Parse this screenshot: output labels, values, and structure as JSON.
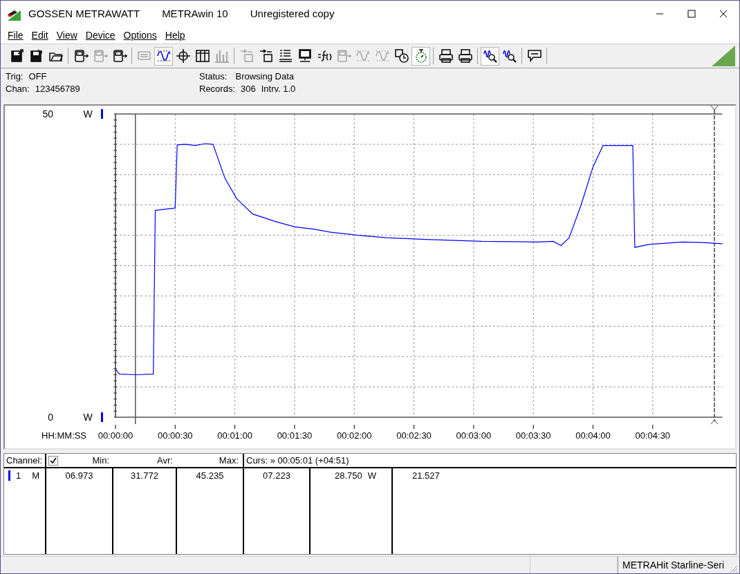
{
  "window": {
    "title_parts": [
      "GOSSEN METRAWATT",
      "METRAwin 10",
      "Unregistered copy"
    ]
  },
  "menu": [
    {
      "label": "File"
    },
    {
      "label": "Edit"
    },
    {
      "label": "View"
    },
    {
      "label": "Device"
    },
    {
      "label": "Options"
    },
    {
      "label": "Help"
    }
  ],
  "toolbar": [
    {
      "buttons": [
        {
          "kind": "disk-out",
          "disabled": false,
          "pressed": false
        },
        {
          "kind": "disk-in",
          "disabled": false,
          "pressed": false
        },
        {
          "kind": "open",
          "disabled": false,
          "pressed": false
        }
      ]
    },
    {
      "buttons": [
        {
          "kind": "meter",
          "disabled": false,
          "pressed": false
        },
        {
          "kind": "meter",
          "disabled": true,
          "pressed": false
        },
        {
          "kind": "meter",
          "disabled": false,
          "pressed": false
        }
      ]
    },
    {
      "buttons": [
        {
          "kind": "display",
          "disabled": true,
          "pressed": false
        },
        {
          "kind": "wave",
          "disabled": false,
          "pressed": true
        },
        {
          "kind": "crosshair",
          "disabled": false,
          "pressed": false
        },
        {
          "kind": "table",
          "disabled": false,
          "pressed": false
        },
        {
          "kind": "bars",
          "disabled": true,
          "pressed": false
        }
      ]
    },
    {
      "buttons": [
        {
          "kind": "transfer",
          "disabled": true,
          "pressed": false
        },
        {
          "kind": "transfer",
          "disabled": false,
          "pressed": false
        },
        {
          "kind": "list",
          "disabled": false,
          "pressed": false
        },
        {
          "kind": "monitor",
          "disabled": false,
          "pressed": false
        },
        {
          "kind": "function",
          "disabled": false,
          "pressed": false
        },
        {
          "kind": "meter",
          "disabled": true,
          "pressed": false
        },
        {
          "kind": "wave",
          "disabled": true,
          "pressed": false
        },
        {
          "kind": "wave",
          "disabled": true,
          "pressed": false
        },
        {
          "kind": "clock",
          "disabled": false,
          "pressed": false
        },
        {
          "kind": "stopwatch",
          "disabled": false,
          "pressed": true
        }
      ]
    },
    {
      "buttons": [
        {
          "kind": "printer",
          "disabled": false,
          "pressed": false
        },
        {
          "kind": "printer",
          "disabled": false,
          "pressed": false
        }
      ]
    },
    {
      "buttons": [
        {
          "kind": "zoom",
          "disabled": false,
          "pressed": true
        },
        {
          "kind": "zoom",
          "disabled": false,
          "pressed": false
        }
      ]
    },
    {
      "buttons": [
        {
          "kind": "comment",
          "disabled": false,
          "pressed": false
        }
      ]
    }
  ],
  "info": {
    "left": [
      {
        "label": "Trig:",
        "value": "OFF"
      },
      {
        "label": "Chan:",
        "value": "123456789"
      }
    ],
    "status": {
      "label": "Status:",
      "value": "Browsing Data"
    },
    "records": {
      "label": "Records:",
      "value": "306",
      "interval": "Intrv. 1.0"
    }
  },
  "chart": {
    "y_units": [
      "W",
      "W"
    ],
    "chart_data": {
      "type": "line",
      "xlabel": "HH:MM:SS",
      "xlim": [
        0,
        305
      ],
      "ylim": [
        0,
        50
      ],
      "yticks": [
        {
          "value": 50,
          "label": "50"
        },
        {
          "value": 0,
          "label": "0"
        }
      ],
      "xticks": [
        {
          "value": 0,
          "label": "00:00:00"
        },
        {
          "value": 30,
          "label": "00:00:30"
        },
        {
          "value": 60,
          "label": "00:01:00"
        },
        {
          "value": 90,
          "label": "00:01:30"
        },
        {
          "value": 120,
          "label": "00:02:00"
        },
        {
          "value": 150,
          "label": "00:02:30"
        },
        {
          "value": 180,
          "label": "00:03:00"
        },
        {
          "value": 210,
          "label": "00:03:30"
        },
        {
          "value": 240,
          "label": "00:04:00"
        },
        {
          "value": 270,
          "label": "00:04:30"
        }
      ],
      "x": [
        0,
        2,
        10,
        19,
        20,
        25,
        30,
        31,
        35,
        40,
        45,
        49,
        55,
        61,
        69,
        80,
        90,
        100,
        108,
        122,
        136,
        156,
        184,
        212,
        220,
        224,
        228,
        234,
        240,
        245,
        260,
        261,
        268,
        285,
        295,
        305
      ],
      "series": [
        {
          "color": "#0000ff",
          "values": [
            7.9,
            7.1,
            7.0,
            7.1,
            34.1,
            34.3,
            34.5,
            44.9,
            45.0,
            44.8,
            45.1,
            45.0,
            39.4,
            36.0,
            33.5,
            32.3,
            31.4,
            31.0,
            30.5,
            30.0,
            29.6,
            29.3,
            29.0,
            28.9,
            29.0,
            28.3,
            29.6,
            35.0,
            41.3,
            44.8,
            44.8,
            28.0,
            28.5,
            28.9,
            28.8,
            28.6
          ]
        }
      ],
      "grid": true,
      "ref_lines": [
        {
          "axis": "x",
          "value": 10
        },
        {
          "axis": "x",
          "value": 301
        }
      ]
    }
  },
  "table": {
    "header": {
      "channel": "Channel:",
      "checked": true,
      "min": "Min:",
      "avr": "Avr:",
      "max": "Max:",
      "cursor": "Curs: » 00:05:01 (+04:51)"
    },
    "rows": [
      {
        "color": "#0000ff",
        "number": "1",
        "mode": "M",
        "min": "06.973",
        "avr": "31.772",
        "max": "45.235",
        "cursor_1": "07.223",
        "cursor_2": "28.750",
        "unit": "W",
        "delta": "21.527"
      }
    ]
  },
  "status_bar": {
    "device": "METRAHit Starline-Seri"
  }
}
